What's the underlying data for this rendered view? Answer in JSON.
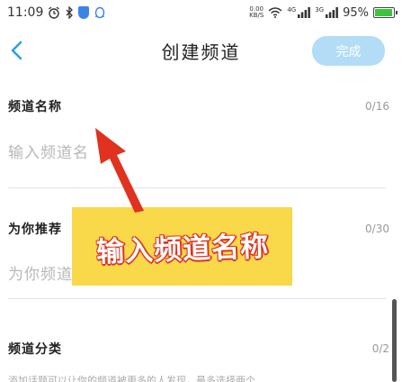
{
  "status_bar": {
    "time": "11:09",
    "net_speed": "0.00",
    "net_unit": "KB/S",
    "net_4g": "4G",
    "net_3g": "3G",
    "battery_percent": "95%",
    "battery_level": 0.95,
    "icons": [
      "alarm-icon",
      "bluetooth-icon",
      "shield-icon",
      "qq-icon",
      "wifi-icon",
      "signal-icon"
    ]
  },
  "header": {
    "title": "创建频道",
    "done_label": "完成",
    "done_color": "#b3dcf7"
  },
  "form": {
    "name": {
      "label": "频道名称",
      "counter": "0/16",
      "placeholder": "输入频道名"
    },
    "recommend": {
      "label": "为你推荐",
      "counter": "0/30",
      "placeholder": "为你频道添"
    },
    "category": {
      "label": "频道分类",
      "counter": "0/2",
      "description": "添加话题可以让你的频道被更多的人发现，最多选择两个"
    }
  },
  "annotation": {
    "text": "输入频道名称",
    "banner_color": "#f9d84a",
    "arrow_color": "#e0321e"
  }
}
